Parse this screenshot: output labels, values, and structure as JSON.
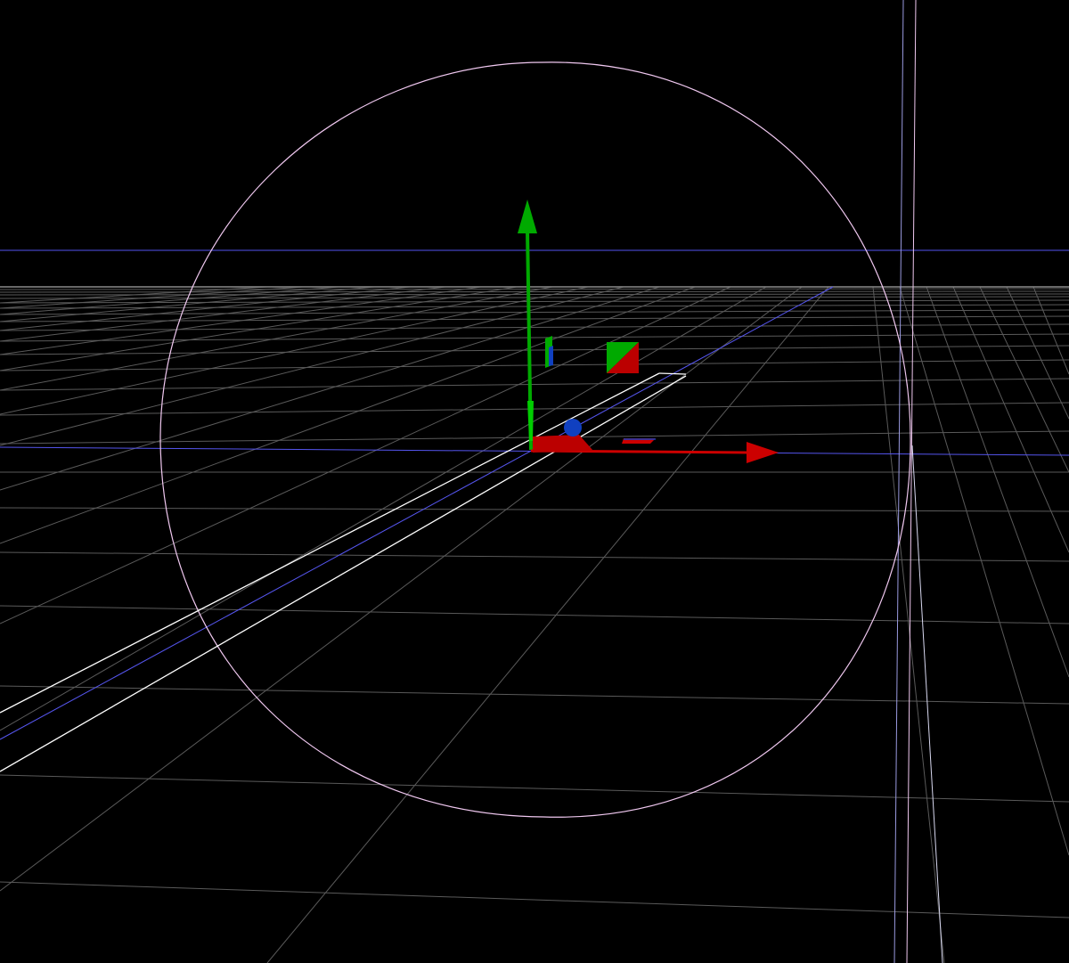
{
  "viewport": {
    "background_color": "#000000"
  },
  "grid": {
    "line_color": "#5a5a5a",
    "horizon_line_color": "#8a8a8a"
  },
  "axes": {
    "x_axis_color": "#cc0000",
    "y_axis_color": "#00aa00",
    "z_axis_color": "#1040c0"
  },
  "guides": {
    "blue_line_color": "#5555ee",
    "selection_outline_color": "#ffffff",
    "bounding_sphere_color": "#f0c8f0"
  },
  "gizmo": {
    "icons": [
      "translate-x-arrow-icon",
      "translate-y-arrow-icon",
      "translate-z-handle-icon",
      "plane-xy-handle-icon",
      "plane-xz-handle-icon",
      "plane-yz-handle-icon"
    ]
  }
}
